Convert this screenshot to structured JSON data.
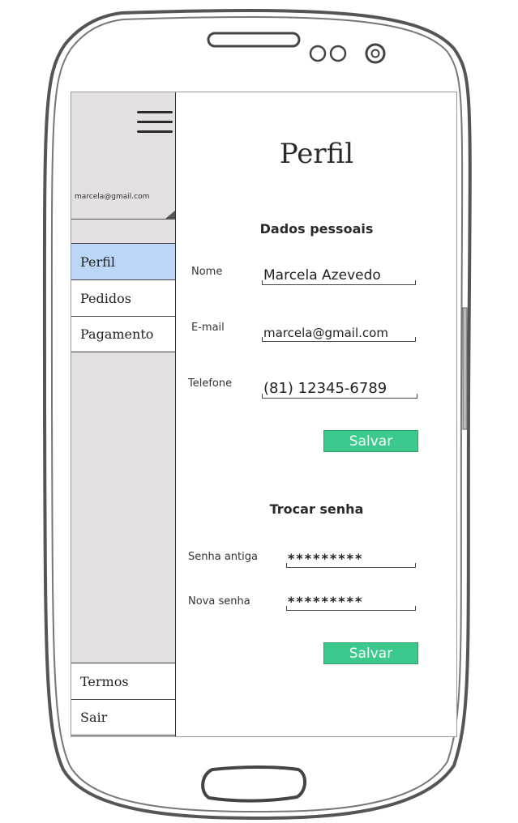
{
  "sidebar": {
    "user_email": "marcela@gmail.com",
    "menu_items": [
      {
        "label": "Perfil"
      },
      {
        "label": "Pedidos"
      },
      {
        "label": "Pagamento"
      }
    ],
    "bottom_items": [
      {
        "label": "Termos"
      },
      {
        "label": "Sair"
      }
    ]
  },
  "main": {
    "title": "Perfil",
    "personal": {
      "heading": "Dados pessoais",
      "name_label": "Nome",
      "name_value": "Marcela Azevedo",
      "email_label": "E-mail",
      "email_value": "marcela@gmail.com",
      "phone_label": "Telefone",
      "phone_value": "(81) 12345-6789",
      "save_label": "Salvar"
    },
    "password": {
      "heading": "Trocar senha",
      "old_label": "Senha antiga",
      "old_value": "*********",
      "new_label": "Nova senha",
      "new_value": "*********",
      "save_label": "Salvar"
    }
  },
  "colors": {
    "active_item": "#bcd6f7",
    "button": "#3cc98c",
    "sidebar_bg": "#e3dfe3"
  },
  "icons": [
    "menu-icon",
    "speaker-slot",
    "front-camera",
    "sensor",
    "home-button"
  ]
}
